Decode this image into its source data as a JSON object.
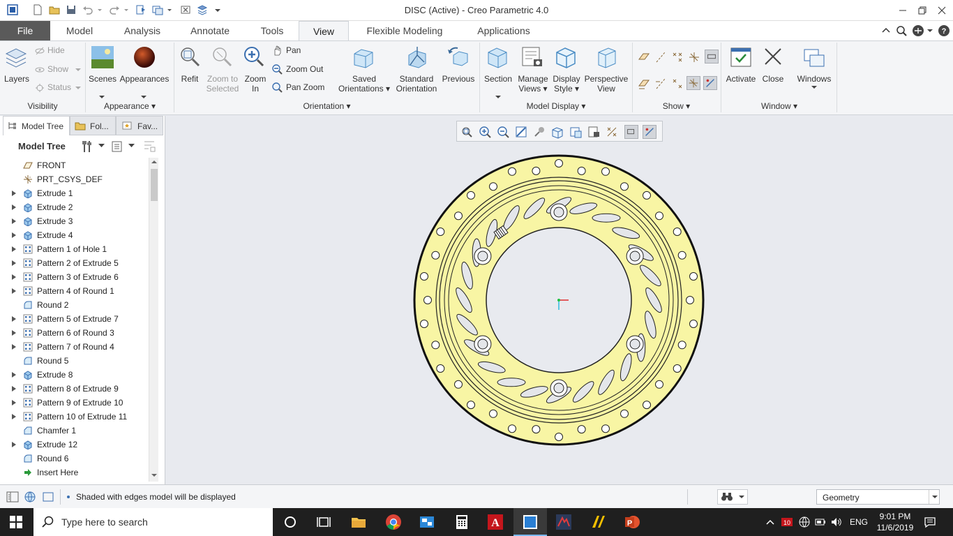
{
  "window": {
    "title": "DISC (Active) - Creo Parametric 4.0"
  },
  "ribbon_tabs": [
    {
      "label": "File"
    },
    {
      "label": "Model"
    },
    {
      "label": "Analysis"
    },
    {
      "label": "Annotate"
    },
    {
      "label": "Tools"
    },
    {
      "label": "View"
    },
    {
      "label": "Flexible Modeling"
    },
    {
      "label": "Applications"
    }
  ],
  "active_tab": "View",
  "ribbon": {
    "visibility": {
      "layers": "Layers",
      "hide": "Hide",
      "show": "Show",
      "status": "Status",
      "group": "Visibility"
    },
    "appearance": {
      "scenes": "Scenes",
      "appearances": "Appearances",
      "group": "Appearance"
    },
    "orientation": {
      "refit": "Refit",
      "zoom_to_selected_1": "Zoom to",
      "zoom_to_selected_2": "Selected",
      "zoom_in_1": "Zoom",
      "zoom_in_2": "In",
      "pan": "Pan",
      "zoom_out": "Zoom Out",
      "pan_zoom": "Pan Zoom",
      "saved_orientations_1": "Saved",
      "saved_orientations_2": "Orientations",
      "standard_orientation_1": "Standard",
      "standard_orientation_2": "Orientation",
      "previous": "Previous",
      "group": "Orientation"
    },
    "model_display": {
      "section": "Section",
      "manage_views_1": "Manage",
      "manage_views_2": "Views",
      "display_style_1": "Display",
      "display_style_2": "Style",
      "perspective_view_1": "Perspective",
      "perspective_view_2": "View",
      "group": "Model Display"
    },
    "show": {
      "group": "Show"
    },
    "window": {
      "activate": "Activate",
      "close": "Close",
      "windows": "Windows",
      "group": "Window"
    }
  },
  "panel_tabs": [
    {
      "label": "Model Tree"
    },
    {
      "label": "Fol..."
    },
    {
      "label": "Fav..."
    }
  ],
  "model_tree": {
    "header": "Model Tree",
    "items": [
      {
        "label": "FRONT",
        "icon": "datum-plane-icon",
        "expandable": false
      },
      {
        "label": "PRT_CSYS_DEF",
        "icon": "csys-icon",
        "expandable": false
      },
      {
        "label": "Extrude 1",
        "icon": "extrude-icon",
        "expandable": true
      },
      {
        "label": "Extrude 2",
        "icon": "extrude-icon",
        "expandable": true
      },
      {
        "label": "Extrude 3",
        "icon": "extrude-icon",
        "expandable": true
      },
      {
        "label": "Extrude 4",
        "icon": "extrude-icon",
        "expandable": true
      },
      {
        "label": "Pattern 1 of Hole 1",
        "icon": "pattern-icon",
        "expandable": true
      },
      {
        "label": "Pattern 2 of Extrude 5",
        "icon": "pattern-icon",
        "expandable": true
      },
      {
        "label": "Pattern 3 of Extrude 6",
        "icon": "pattern-icon",
        "expandable": true
      },
      {
        "label": "Pattern 4 of Round 1",
        "icon": "pattern-icon",
        "expandable": true
      },
      {
        "label": "Round 2",
        "icon": "round-icon",
        "expandable": false
      },
      {
        "label": "Pattern 5 of Extrude 7",
        "icon": "pattern-icon",
        "expandable": true
      },
      {
        "label": "Pattern 6 of Round 3",
        "icon": "pattern-icon",
        "expandable": true
      },
      {
        "label": "Pattern 7 of Round 4",
        "icon": "pattern-icon",
        "expandable": true
      },
      {
        "label": "Round 5",
        "icon": "round-icon",
        "expandable": false
      },
      {
        "label": "Extrude 8",
        "icon": "extrude-icon",
        "expandable": true
      },
      {
        "label": "Pattern 8 of Extrude 9",
        "icon": "pattern-icon",
        "expandable": true
      },
      {
        "label": "Pattern 9 of Extrude 10",
        "icon": "pattern-icon",
        "expandable": true
      },
      {
        "label": "Pattern 10 of Extrude 11",
        "icon": "pattern-icon",
        "expandable": true
      },
      {
        "label": "Chamfer 1",
        "icon": "chamfer-icon",
        "expandable": false
      },
      {
        "label": "Extrude 12",
        "icon": "extrude-icon",
        "expandable": true
      },
      {
        "label": "Round 6",
        "icon": "round-icon",
        "expandable": false
      },
      {
        "label": "Insert Here",
        "icon": "insert-here-icon",
        "expandable": false
      }
    ]
  },
  "status": {
    "message": "Shaded with edges model will be displayed",
    "filter_value": "Geometry"
  },
  "taskbar": {
    "search_placeholder": "Type here to search",
    "language": "ENG",
    "time": "9:01 PM",
    "date": "11/6/2019"
  },
  "colors": {
    "disc_fill": "#f8f5a4",
    "file_tab": "#5a5a5a",
    "graphics_bg": "#e8eaef",
    "taskbar": "#1f1f1f"
  }
}
